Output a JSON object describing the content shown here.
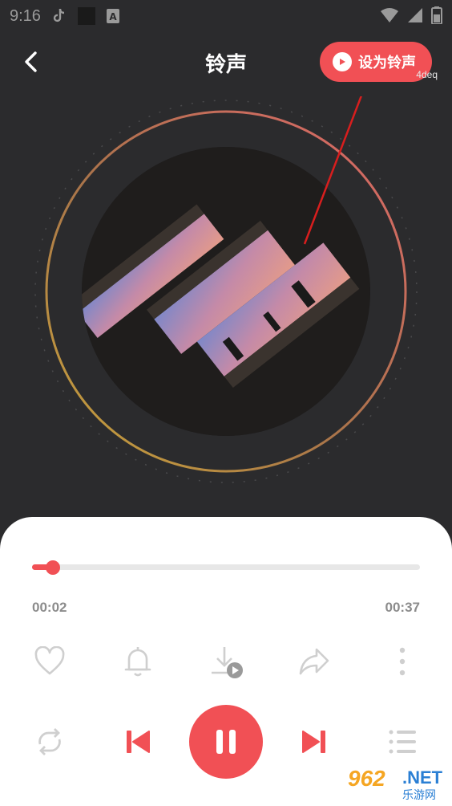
{
  "status_bar": {
    "time": "9:16"
  },
  "header": {
    "title": "铃声",
    "set_ringtone_label": "设为铃声",
    "corner_tag": "4deq"
  },
  "player": {
    "current_time": "00:02",
    "total_time": "00:37",
    "progress": 0.054
  },
  "actions": [
    "favorite-icon",
    "bell-icon",
    "download-icon",
    "share-icon",
    "more-icon"
  ],
  "controls": [
    "repeat-icon",
    "previous-icon",
    "pause-icon",
    "next-icon",
    "playlist-icon"
  ],
  "watermark": {
    "logo": "962",
    "suffix": ".NET",
    "cn": "乐游网"
  },
  "colors": {
    "accent": "#f15055",
    "background": "#2b2b2d",
    "panel": "#ffffff",
    "muted": "#8c8c8c"
  }
}
